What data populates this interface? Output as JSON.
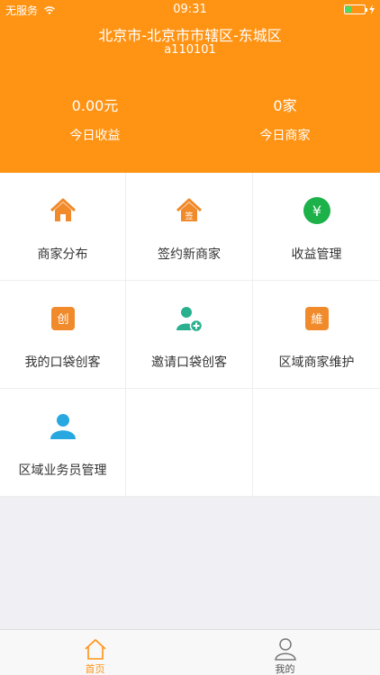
{
  "status_bar": {
    "carrier": "无服务",
    "time": "09:31"
  },
  "header": {
    "region": "北京市-北京市市辖区-东城区",
    "code": "a110101",
    "stats": [
      {
        "value": "0.00元",
        "label": "今日收益"
      },
      {
        "value": "0家",
        "label": "今日商家"
      }
    ]
  },
  "menu": [
    {
      "label": "商家分布",
      "icon": "house-icon"
    },
    {
      "label": "签约新商家",
      "icon": "house-sign-icon",
      "glyph": "签"
    },
    {
      "label": "收益管理",
      "icon": "yen-icon",
      "glyph": "¥"
    },
    {
      "label": "我的口袋创客",
      "icon": "chuang-icon",
      "glyph": "创"
    },
    {
      "label": "邀请口袋创客",
      "icon": "add-user-icon"
    },
    {
      "label": "区域商家维护",
      "icon": "wei-icon",
      "glyph": "維"
    },
    {
      "label": "区域业务员管理",
      "icon": "user-icon"
    }
  ],
  "tabbar": [
    {
      "label": "首页",
      "active": true
    },
    {
      "label": "我的",
      "active": false
    }
  ],
  "colors": {
    "accent": "#ff9313",
    "green": "#1db14a",
    "teal": "#2bb08f",
    "user_blue": "#27a8e0"
  }
}
